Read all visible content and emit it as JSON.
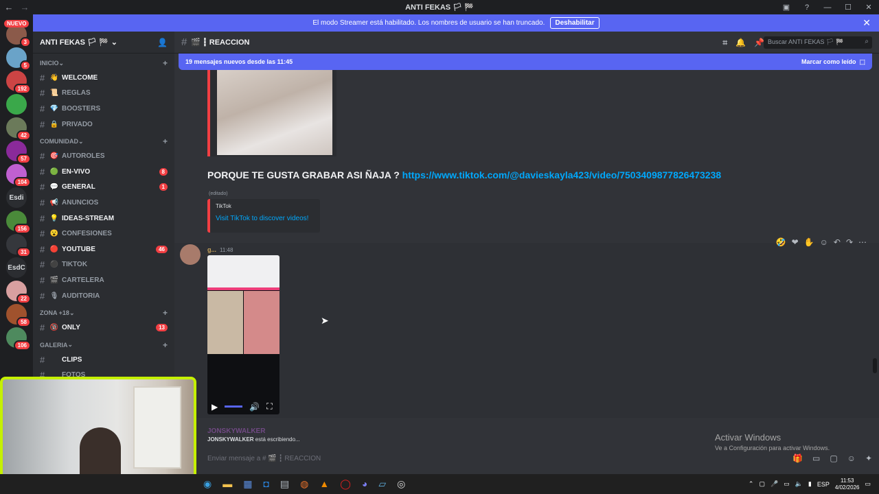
{
  "window": {
    "title": "ANTI FEKAS 🏳 🏁"
  },
  "banner": {
    "text": "El modo Streamer está habilitado. Los nombres de usuario se han truncado.",
    "button": "Deshabilitar"
  },
  "servers": {
    "nuevo": "NUEVO",
    "badges": [
      "3",
      "5",
      "192",
      "42",
      "57",
      "104",
      "156",
      "31",
      "22",
      "58",
      "106"
    ],
    "text_servers": [
      "Esdi",
      "EsdC"
    ]
  },
  "guild": {
    "name": "ANTI FEKAS 🏳 🏁"
  },
  "sidebar": {
    "categories": [
      {
        "name": "INICIO",
        "channels": [
          {
            "emoji": "👋",
            "name": "WELCOME",
            "unread": true,
            "count": ""
          },
          {
            "emoji": "📜",
            "name": "REGLAS",
            "unread": false,
            "count": ""
          },
          {
            "emoji": "💎",
            "name": "BOOSTERS",
            "unread": false,
            "count": ""
          },
          {
            "emoji": "🔒",
            "name": "PRIVADO",
            "unread": false,
            "count": ""
          }
        ]
      },
      {
        "name": "COMUNIDAD",
        "channels": [
          {
            "emoji": "🎯",
            "name": "AUTOROLES",
            "unread": false,
            "count": ""
          },
          {
            "emoji": "🟢",
            "name": "EN-VIVO",
            "unread": true,
            "count": "8"
          },
          {
            "emoji": "💬",
            "name": "GENERAL",
            "unread": true,
            "count": "1"
          },
          {
            "emoji": "📢",
            "name": "ANUNCIOS",
            "unread": false,
            "count": ""
          },
          {
            "emoji": "💡",
            "name": "IDEAS-STREAM",
            "unread": true,
            "count": ""
          },
          {
            "emoji": "😮",
            "name": "CONFESIONES",
            "unread": false,
            "count": ""
          },
          {
            "emoji": "🔴",
            "name": "YOUTUBE",
            "unread": true,
            "count": "46"
          },
          {
            "emoji": "⚫",
            "name": "TIKTOK",
            "unread": false,
            "count": ""
          },
          {
            "emoji": "🎬",
            "name": "CARTELERA",
            "unread": false,
            "count": ""
          },
          {
            "emoji": "🎙",
            "name": "AUDITORIA",
            "unread": false,
            "count": ""
          }
        ]
      },
      {
        "name": "ZONA +18",
        "channels": [
          {
            "emoji": "🔞",
            "name": "ONLY",
            "unread": true,
            "count": "13"
          }
        ]
      },
      {
        "name": "GALERIA",
        "channels": [
          {
            "emoji": "",
            "name": "CLIPS",
            "unread": true,
            "count": ""
          },
          {
            "emoji": "",
            "name": "FOTOS",
            "unread": false,
            "count": ""
          }
        ]
      }
    ]
  },
  "channel": {
    "name": "🎬 ┇ REACCION",
    "search_placeholder": "Buscar ANTI FEKAS 🏳 🏁"
  },
  "newbar": {
    "text": "19 mensajes nuevos desde las 11:45",
    "action": "Marcar como leído"
  },
  "message1": {
    "text": "PORQUE TE GUSTA GRABAR ASI ÑAJA ?",
    "link": "https://www.tiktok.com/@davieskayla423/video/7503409877826473238",
    "edited": "(editado)",
    "embed_provider": "TikTok",
    "embed_title": "Visit TikTok to discover videos!"
  },
  "message2": {
    "author": "g...",
    "time": "11:48"
  },
  "typing": {
    "name": "JONSKYWALKER",
    "user": "JONSKYWALKER",
    "text": "está escribiendo..."
  },
  "composer": {
    "placeholder": "Enviar mensaje a # 🎬 ┇ REACCION"
  },
  "watermark": {
    "title": "Activar Windows",
    "subtitle": "Ve a Configuración para activar Windows."
  },
  "taskbar": {
    "lang": "ESP",
    "time": "11:53",
    "date": "4/02/2026"
  }
}
